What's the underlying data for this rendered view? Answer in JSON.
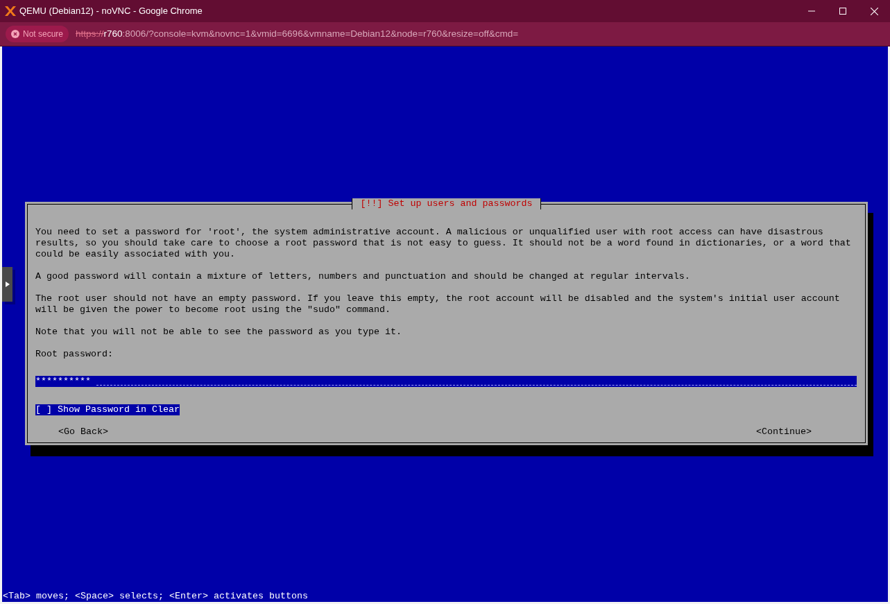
{
  "window": {
    "title": "QEMU (Debian12) - noVNC - Google Chrome"
  },
  "address_bar": {
    "security": "Not secure",
    "scheme": "https://",
    "host": "r760",
    "rest": ":8006/?console=kvm&novnc=1&vmid=6696&vmname=Debian12&node=r760&resize=off&cmd="
  },
  "dialog": {
    "title": "[!!] Set up users and passwords",
    "paragraphs": [
      "You need to set a password for 'root', the system administrative account. A malicious or unqualified user with root access can have disastrous results, so you should take care to choose a root password that is not easy to guess. It should not be a word found in dictionaries, or a word that could be easily associated with you.",
      "A good password will contain a mixture of letters, numbers and punctuation and should be changed at regular intervals.",
      "The root user should not have an empty password. If you leave this empty, the root account will be disabled and the system's initial user account will be given the power to become root using the \"sudo\" command.",
      "Note that you will not be able to see the password as you type it."
    ],
    "field_label": "Root password:",
    "password": {
      "value": "**********",
      "focused": true
    },
    "checkbox": {
      "mark": "[ ]",
      "label": "Show Password in Clear",
      "focused": true
    },
    "buttons": [
      {
        "label": "<Go Back>",
        "focused": false
      },
      {
        "label": "<Continue>",
        "focused": false
      }
    ]
  },
  "status_line": "<Tab> moves; <Space> selects; <Enter> activates buttons"
}
